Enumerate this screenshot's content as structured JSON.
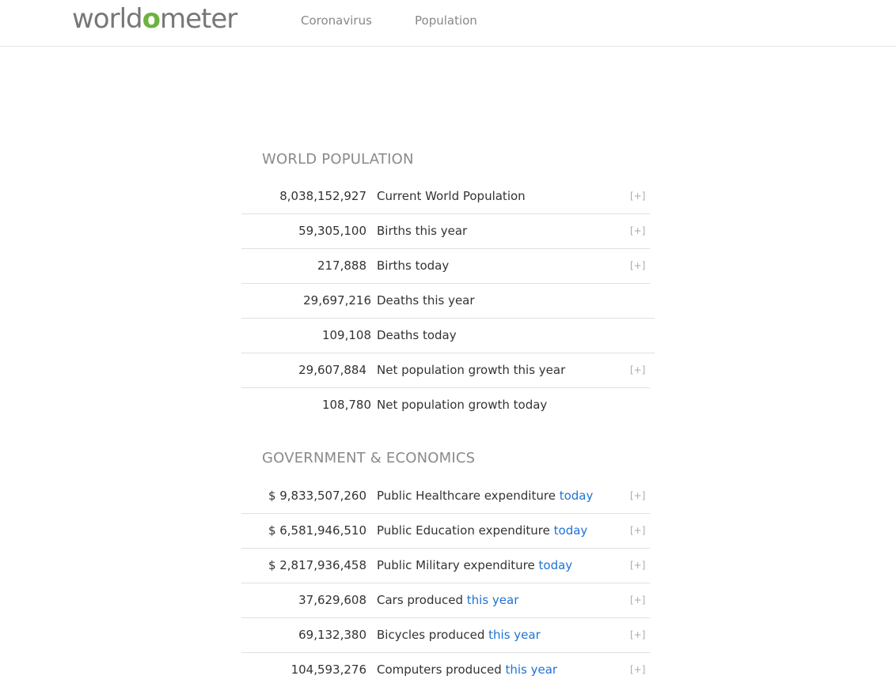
{
  "header": {
    "logo_pre": "world",
    "logo_o": "o",
    "logo_post": "meter",
    "nav": [
      "Coronavirus",
      "Population"
    ]
  },
  "world_population": {
    "title": "WORLD POPULATION",
    "rows": [
      {
        "value": "8,038,152,927",
        "label": "Current World Population",
        "expand": "[+]"
      },
      {
        "value": "59,305,100",
        "label": "Births this year",
        "expand": "[+]"
      },
      {
        "value": "217,888",
        "label": "Births today",
        "expand": "[+]"
      },
      {
        "value": "29,697,216",
        "label": "Deaths this year"
      },
      {
        "value": "109,108",
        "label": "Deaths today"
      },
      {
        "value": "29,607,884",
        "label": "Net population growth this year",
        "expand": "[+]"
      },
      {
        "value": "108,780",
        "label": "Net population growth today"
      }
    ]
  },
  "government_economics": {
    "title": "GOVERNMENT & ECONOMICS",
    "rows": [
      {
        "value": "$ 9,833,507,260",
        "label": "Public Healthcare expenditure",
        "link": "today",
        "expand": "[+]"
      },
      {
        "value": "$ 6,581,946,510",
        "label": "Public Education expenditure",
        "link": "today",
        "expand": "[+]"
      },
      {
        "value": "$ 2,817,936,458",
        "label": "Public Military expenditure",
        "link": "today",
        "expand": "[+]"
      },
      {
        "value": "37,629,608",
        "label": "Cars produced",
        "link": "this year",
        "expand": "[+]"
      },
      {
        "value": "69,132,380",
        "label": "Bicycles produced",
        "link": "this year",
        "expand": "[+]"
      },
      {
        "value": "104,593,276",
        "label": "Computers produced",
        "link": "this year",
        "expand": "[+]"
      }
    ]
  }
}
